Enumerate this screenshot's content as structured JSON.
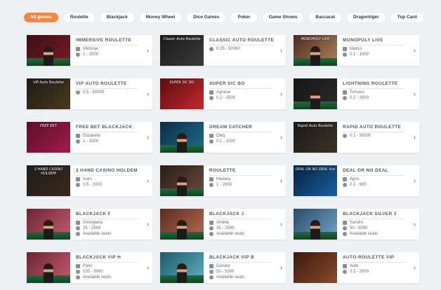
{
  "filters": [
    {
      "label": "All games",
      "active": true
    },
    {
      "label": "Roulette",
      "active": false
    },
    {
      "label": "Blackjack",
      "active": false
    },
    {
      "label": "Money Wheel",
      "active": false
    },
    {
      "label": "Dice Games",
      "active": false
    },
    {
      "label": "Poker",
      "active": false
    },
    {
      "label": "Game Shows",
      "active": false
    },
    {
      "label": "Baccarat",
      "active": false
    },
    {
      "label": "Dragontiger",
      "active": false
    },
    {
      "label": "Top Card",
      "active": false
    }
  ],
  "games": [
    {
      "title": "IMMERSIVE ROULETTE",
      "dealer": "Viktorija",
      "limits": "1 - 2000",
      "seats": "",
      "thumb_text": "",
      "thumb_colors": [
        "#3a0f14",
        "#7a1c25"
      ],
      "figure": true
    },
    {
      "title": "CLASSIC AUTO ROULETTE",
      "dealer": "",
      "limits": "0.25 - 50000",
      "seats": "",
      "thumb_text": "Classic Auto Roulette",
      "thumb_colors": [
        "#1a1a1a",
        "#3b3b3b"
      ],
      "figure": false
    },
    {
      "title": "MONOPOLY LIVE",
      "dealer": "Matiss",
      "limits": "0.1 - 1000",
      "seats": "",
      "thumb_text": "MONOPOLY LIVE",
      "thumb_colors": [
        "#4b2a20",
        "#b0845e"
      ],
      "figure": true
    },
    {
      "title": "VIP AUTO ROULETTE",
      "dealer": "",
      "limits": "0.5 - 50000",
      "seats": "",
      "thumb_text": "VIP Auto Roulette",
      "thumb_colors": [
        "#1b1b1b",
        "#4a3a1a"
      ],
      "figure": false
    },
    {
      "title": "SUPER SIC BO",
      "dealer": "Agnese",
      "limits": "0.2 - 2500",
      "seats": "",
      "thumb_text": "SUPER SIC BO",
      "thumb_colors": [
        "#5a0d10",
        "#c6282b"
      ],
      "figure": false
    },
    {
      "title": "LIGHTNING ROULETTE",
      "dealer": "Tomass",
      "limits": "0.2 - 2000",
      "seats": "",
      "thumb_text": "",
      "thumb_colors": [
        "#151515",
        "#2c2c2c"
      ],
      "figure": true
    },
    {
      "title": "FREE BET BLACKJACK",
      "dealer": "Elizabete",
      "limits": "1 - 1000",
      "seats": "",
      "thumb_text": "FREE BET",
      "thumb_colors": [
        "#5c0f2a",
        "#a11b4a"
      ],
      "figure": false
    },
    {
      "title": "DREAM CATCHER",
      "dealer": "Oleg",
      "limits": "0.1 - 1000",
      "seats": "",
      "thumb_text": "",
      "thumb_colors": [
        "#0d2b44",
        "#1e6f8f"
      ],
      "figure": true
    },
    {
      "title": "RAPID AUTO ROULETTE",
      "dealer": "",
      "limits": "0.1 - 50000",
      "seats": "",
      "thumb_text": "Rapid Auto Roulette",
      "thumb_colors": [
        "#1a1a1a",
        "#3d3224"
      ],
      "figure": false
    },
    {
      "title": "2 HAND CASINO HOLDEM",
      "dealer": "Ivars",
      "limits": "0.5 - 1000",
      "seats": "",
      "thumb_text": "2 HAND CASINO HOLDEM",
      "thumb_colors": [
        "#1c1c1c",
        "#3a2a1a"
      ],
      "figure": false
    },
    {
      "title": "ROULETTE",
      "dealer": "Madara",
      "limits": "1 - 2000",
      "seats": "",
      "thumb_text": "",
      "thumb_colors": [
        "#2a1d18",
        "#6a4b3a"
      ],
      "figure": true
    },
    {
      "title": "DEAL OR NO DEAL",
      "dealer": "Agris",
      "limits": "0.1 - 900",
      "seats": "",
      "thumb_text": "DEAL OR NO DEAL live",
      "thumb_colors": [
        "#08223f",
        "#1660a0"
      ],
      "figure": false
    },
    {
      "title": "BLACKJACK F",
      "dealer": "Georgiana",
      "limits": "25 - 2500",
      "seats": "Available seats",
      "thumb_text": "",
      "thumb_colors": [
        "#6a2535",
        "#c55c70"
      ],
      "figure": true
    },
    {
      "title": "BLACKJACK J",
      "dealer": "Amelie",
      "limits": "35 - 2500",
      "seats": "Available seats",
      "thumb_text": "",
      "thumb_colors": [
        "#5b2c20",
        "#b56d52"
      ],
      "figure": true
    },
    {
      "title": "BLACKJACK SILVER 3",
      "dealer": "Sandro",
      "limits": "50 - 5000",
      "seats": "Available seats",
      "thumb_text": "",
      "thumb_colors": [
        "#2a4a66",
        "#6fa7cc"
      ],
      "figure": true
    },
    {
      "title": "BLACKJACK VIP H",
      "dealer": "Pako",
      "limits": "100 - 5000",
      "seats": "Available seats",
      "thumb_text": "",
      "thumb_colors": [
        "#6a2535",
        "#c55c70"
      ],
      "figure": true
    },
    {
      "title": "BLACKJACK VIP B",
      "dealer": "Danata",
      "limits": "50 - 5000",
      "seats": "Available seats",
      "thumb_text": "",
      "thumb_colors": [
        "#1e5a6a",
        "#5fb1c2"
      ],
      "figure": true
    },
    {
      "title": "AUTO-ROULETTE VIP",
      "dealer": "Auto",
      "limits": "0.2 - 2000",
      "seats": "",
      "thumb_text": "",
      "thumb_colors": [
        "#3a1a10",
        "#8a4a2a"
      ],
      "figure": false
    }
  ]
}
